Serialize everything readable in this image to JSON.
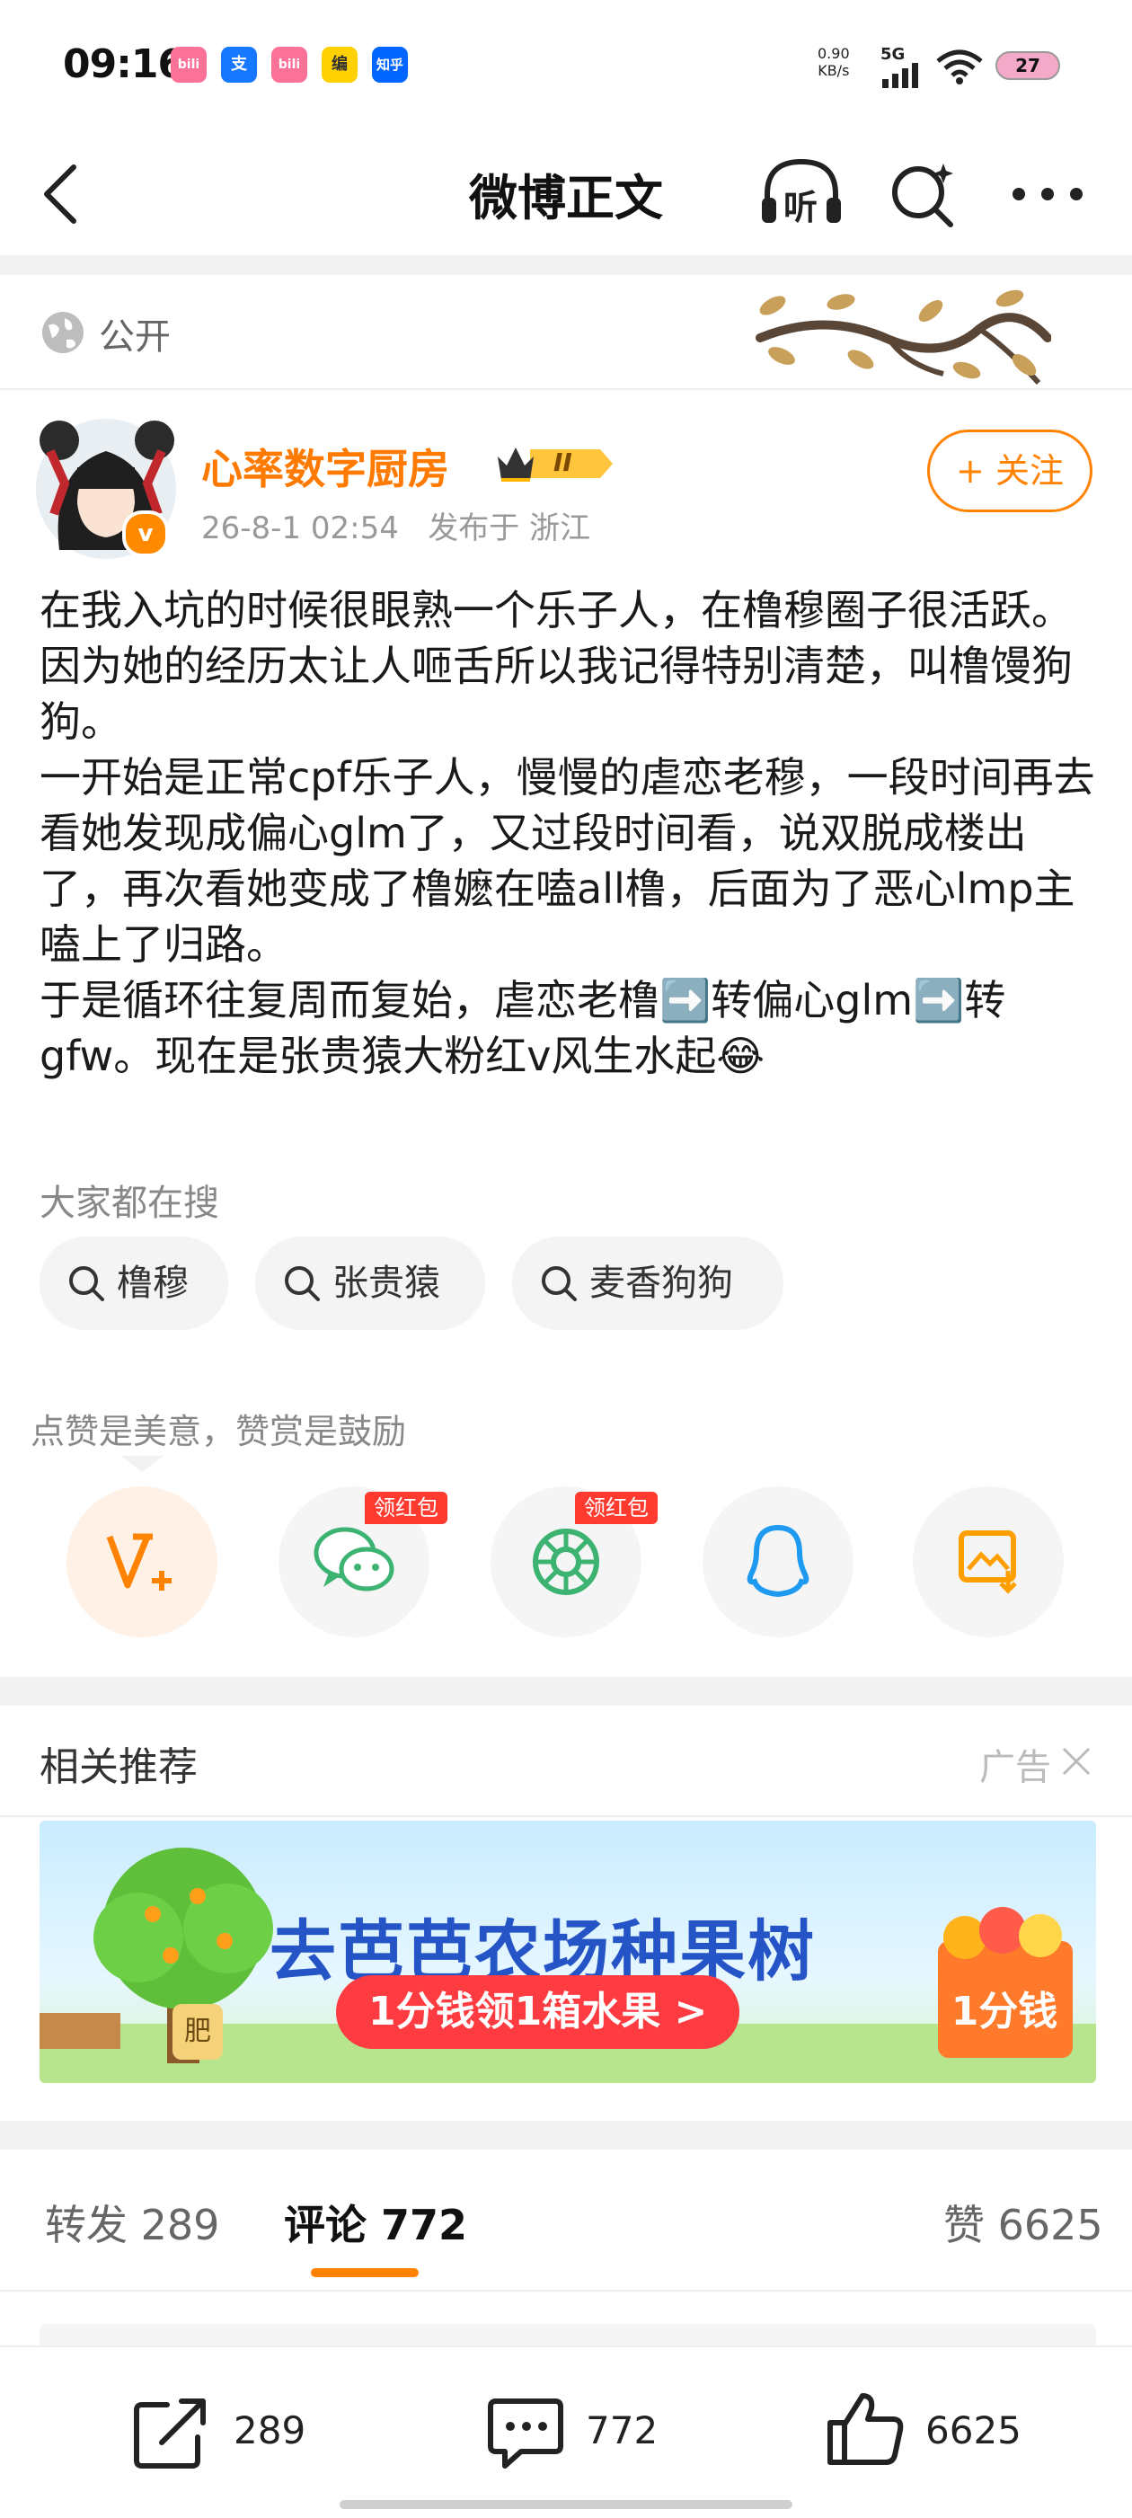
{
  "status_bar": {
    "time": "09:16",
    "app_icons": [
      {
        "name": "bilibili-icon",
        "text": "bili",
        "color": "#fb7299"
      },
      {
        "name": "alipay-icon",
        "text": "支",
        "color": "#1677ff"
      },
      {
        "name": "bilibili-icon-2",
        "text": "bili",
        "color": "#fb7299"
      },
      {
        "name": "app-yellow-icon",
        "text": "编",
        "color": "#ffd100"
      },
      {
        "name": "zhihu-icon",
        "text": "知乎",
        "color": "#0066ff"
      }
    ],
    "net_speed_value": "0.90",
    "net_speed_unit": "KB/s",
    "network": "5G",
    "battery": "27"
  },
  "nav": {
    "title": "微博正文",
    "listen_label": "听"
  },
  "visibility": {
    "label": "公开"
  },
  "author": {
    "name": "心率数字厨房",
    "vip_level": "II",
    "verified_badge": "v",
    "time": "26-8-1 02:54",
    "location": "发布于 浙江",
    "follow_label": "+ 关注"
  },
  "post": {
    "paragraphs": [
      "在我入坑的时候很眼熟一个乐子人，在橹穆圈子很活跃。",
      "因为她的经历太让人咂舌所以我记得特别清楚，叫橹馒狗狗。",
      "一开始是正常cpf乐子人，慢慢的虐恋老穆，一段时间再去看她发现成偏心glm了，又过段时间看，说双脱成楼出了，再次看她变成了橹嬷在嗑all橹，后面为了恶心lmp主嗑上了归路。",
      "于是循环往复周而复始，虐恋老橹➡️转偏心glm➡️转gfw。现在是张贵猿大粉红v风生水起😂"
    ]
  },
  "trending": {
    "label": "大家都在搜",
    "chips": [
      "橹穆",
      "张贵猿",
      "麦香狗狗"
    ]
  },
  "reward": {
    "hint": "点赞是美意，赞赏是鼓励",
    "red_packet_tag": "领红包"
  },
  "related": {
    "title": "相关推荐",
    "ad_label": "广告"
  },
  "ad_banner": {
    "headline": "去芭芭农场种果树",
    "cta": "1分钱领1箱水果 >",
    "box_label": "1分钱",
    "pot_label": "肥"
  },
  "tabs": {
    "repost": "转发 289",
    "comments": "评论 772",
    "likes": "赞 6625"
  },
  "bottom_bar": {
    "repost_count": "289",
    "comment_count": "772",
    "like_count": "6625"
  },
  "colors": {
    "accent": "#ff8200",
    "username": "#ff7a00",
    "red_tag": "#ff3b30"
  }
}
